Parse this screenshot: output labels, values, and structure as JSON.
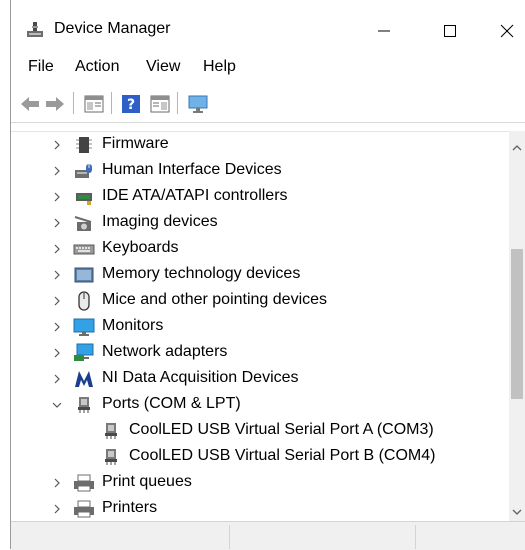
{
  "window": {
    "title": "Device Manager"
  },
  "menu": [
    "File",
    "Action",
    "View",
    "Help"
  ],
  "tree": [
    {
      "label": "Firmware",
      "icon": "firmware-icon",
      "expanded": false
    },
    {
      "label": "Human Interface Devices",
      "icon": "hid-icon",
      "expanded": false
    },
    {
      "label": "IDE ATA/ATAPI controllers",
      "icon": "ide-controller-icon",
      "expanded": false
    },
    {
      "label": "Imaging devices",
      "icon": "camera-icon",
      "expanded": false
    },
    {
      "label": "Keyboards",
      "icon": "keyboard-icon",
      "expanded": false
    },
    {
      "label": "Memory technology devices",
      "icon": "memory-icon",
      "expanded": false
    },
    {
      "label": "Mice and other pointing devices",
      "icon": "mouse-icon",
      "expanded": false
    },
    {
      "label": "Monitors",
      "icon": "monitor-icon",
      "expanded": false
    },
    {
      "label": "Network adapters",
      "icon": "network-adapter-icon",
      "expanded": false
    },
    {
      "label": "NI Data Acquisition Devices",
      "icon": "ni-icon",
      "expanded": false
    },
    {
      "label": "Ports (COM & LPT)",
      "icon": "port-icon",
      "expanded": true
    },
    {
      "label": "CoolLED USB Virtual Serial Port A (COM3)",
      "icon": "port-icon",
      "child": true
    },
    {
      "label": "CoolLED USB Virtual Serial Port B (COM4)",
      "icon": "port-icon",
      "child": true
    },
    {
      "label": "Print queues",
      "icon": "printer-icon",
      "expanded": false
    },
    {
      "label": "Printers",
      "icon": "printer-icon",
      "expanded": false
    }
  ],
  "colors": {
    "accent": "#1e6fd1",
    "titlebar": "#ffffff",
    "status": "#f0f0f0"
  }
}
